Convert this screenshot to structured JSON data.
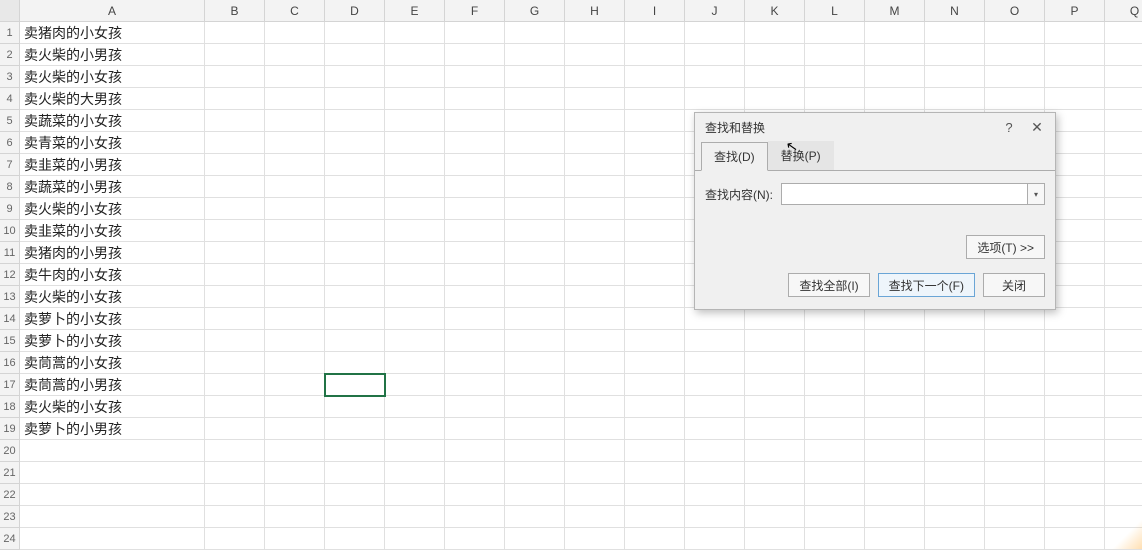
{
  "columns": [
    "A",
    "B",
    "C",
    "D",
    "E",
    "F",
    "G",
    "H",
    "I",
    "J",
    "K",
    "L",
    "M",
    "N",
    "O",
    "P",
    "Q"
  ],
  "rowCount": 24,
  "selectedCell": {
    "row": 17,
    "col": 4
  },
  "cells": {
    "A1": "卖猪肉的小女孩",
    "A2": "卖火柴的小男孩",
    "A3": "卖火柴的小女孩",
    "A4": "卖火柴的大男孩",
    "A5": "卖蔬菜的小女孩",
    "A6": "卖青菜的小女孩",
    "A7": "卖韭菜的小男孩",
    "A8": "卖蔬菜的小男孩",
    "A9": "卖火柴的小女孩",
    "A10": "卖韭菜的小女孩",
    "A11": "卖猪肉的小男孩",
    "A12": "卖牛肉的小女孩",
    "A13": "卖火柴的小女孩",
    "A14": "卖萝卜的小女孩",
    "A15": "卖萝卜的小女孩",
    "A16": "卖茼蒿的小女孩",
    "A17": "卖茼蒿的小男孩",
    "A18": "卖火柴的小女孩",
    "A19": "卖萝卜的小男孩"
  },
  "dialog": {
    "title": "查找和替换",
    "tabs": {
      "find": "查找(D)",
      "replace": "替换(P)"
    },
    "findLabel": "查找内容(N):",
    "findValue": "",
    "optionsBtn": "选项(T) >>",
    "findAllBtn": "查找全部(I)",
    "findNextBtn": "查找下一个(F)",
    "closeBtn": "关闭",
    "helpGlyph": "?",
    "closeGlyph": "✕",
    "ddGlyph": "▾"
  }
}
